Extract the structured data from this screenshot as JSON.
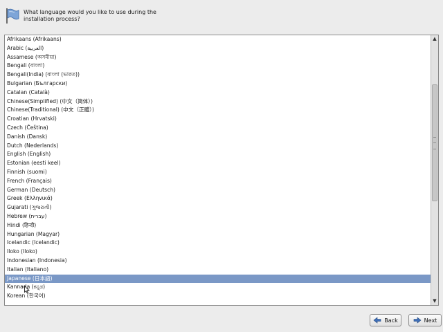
{
  "header": {
    "question": "What language would you like to use during the\ninstallation process?"
  },
  "languages": {
    "items": [
      "Afrikaans (Afrikaans)",
      "Arabic (العربية)",
      "Assamese (অসমীয়া)",
      "Bengali (বাংলা)",
      "Bengali(India) (বাংলা (ভারত))",
      "Bulgarian (Български)",
      "Catalan (Català)",
      "Chinese(Simplified) (中文（简体）)",
      "Chinese(Traditional) (中文（正體）)",
      "Croatian (Hrvatski)",
      "Czech (Čeština)",
      "Danish (Dansk)",
      "Dutch (Nederlands)",
      "English (English)",
      "Estonian (eesti keel)",
      "Finnish (suomi)",
      "French (Français)",
      "German (Deutsch)",
      "Greek (Ελληνικά)",
      "Gujarati (ગુજરાતી)",
      "Hebrew (עברית)",
      "Hindi (हिन्दी)",
      "Hungarian (Magyar)",
      "Icelandic (Icelandic)",
      "Iloko (Iloko)",
      "Indonesian (Indonesia)",
      "Italian (Italiano)",
      "Japanese (日本語)",
      "Kannada (ಕನ್ನಡ)",
      "Korean (한국어)"
    ],
    "selected": "Japanese (日本語)",
    "scroll": {
      "thumb_position": 0.3,
      "thumb_fraction": 0.46
    }
  },
  "buttons": {
    "back_label": "Back",
    "next_label": "Next"
  },
  "icons": {
    "header": "language-flag-icon",
    "back": "back-arrow-icon",
    "next": "next-arrow-icon",
    "scroll_up": "scroll-up-arrow-icon",
    "scroll_down": "scroll-down-arrow-icon"
  },
  "colors": {
    "selected_row": "#7a98c6",
    "arrow_blue": "#3e6fb8"
  }
}
